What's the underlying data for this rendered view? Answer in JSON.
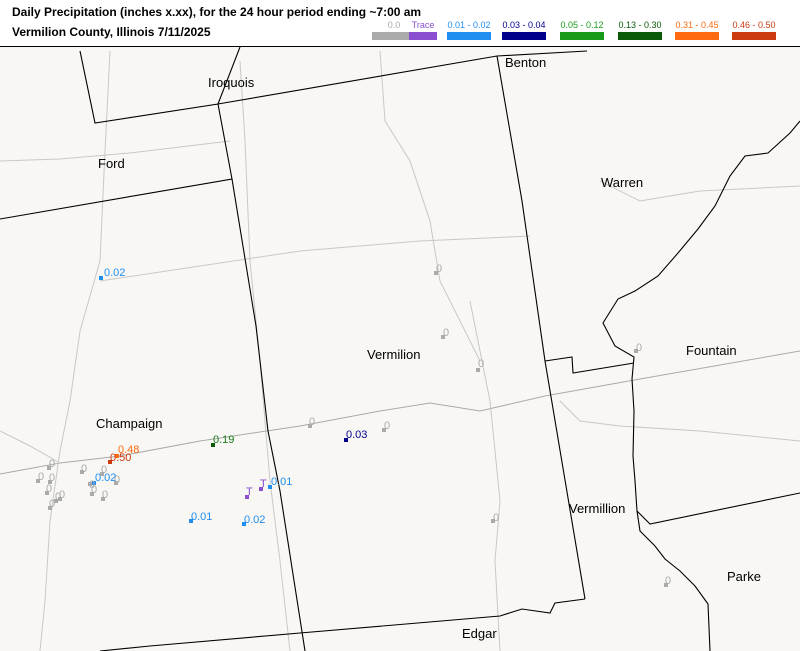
{
  "title_line1": "Daily Precipitation (inches  x.xx),  for the 24 hour period ending ~7:00 am",
  "title_line2": "Vermilion County, Illinois  7/11/2025",
  "legend": [
    {
      "label": "0.0",
      "color": "#aaaaaa"
    },
    {
      "label": "Trace",
      "color": "#8a4fd0"
    },
    {
      "label": "0.01 - 0.02",
      "color": "#1f8ef0"
    },
    {
      "label": "0.03 - 0.04",
      "color": "#00008b"
    },
    {
      "label": "0.05 - 0.12",
      "color": "#1a9a1a"
    },
    {
      "label": "0.13 - 0.30",
      "color": "#0a5a0a"
    },
    {
      "label": "0.31 - 0.45",
      "color": "#ff6a10"
    },
    {
      "label": "0.46 - 0.50",
      "color": "#cc3a10"
    }
  ],
  "counties": {
    "iroquois": "Iroquois",
    "benton": "Benton",
    "ford": "Ford",
    "warren": "Warren",
    "vermilion_il": "Vermilion",
    "fountain": "Fountain",
    "champaign": "Champaign",
    "vermillion_in": "Vermillion",
    "parke": "Parke",
    "edgar": "Edgar"
  },
  "stations": [
    {
      "value": "0.02",
      "color": "#1f8ef0"
    },
    {
      "value": "0",
      "color": "#aaaaaa"
    },
    {
      "value": "0",
      "color": "#aaaaaa"
    },
    {
      "value": "0",
      "color": "#aaaaaa"
    },
    {
      "value": "0",
      "color": "#aaaaaa"
    },
    {
      "value": "0",
      "color": "#aaaaaa"
    },
    {
      "value": "0",
      "color": "#aaaaaa"
    },
    {
      "value": "0",
      "color": "#aaaaaa"
    },
    {
      "value": "0.03",
      "color": "#00008b"
    },
    {
      "value": "0.19",
      "color": "#1a7a1a"
    },
    {
      "value": "0.48",
      "color": "#ff6a10"
    },
    {
      "value": "0.50",
      "color": "#cc3a10"
    },
    {
      "value": "0.02",
      "color": "#1f8ef0"
    },
    {
      "value": "T",
      "color": "#8a4fd0"
    },
    {
      "value": "T",
      "color": "#8a4fd0"
    },
    {
      "value": "0.01",
      "color": "#1f8ef0"
    },
    {
      "value": "0.01",
      "color": "#1f8ef0"
    },
    {
      "value": "0.02",
      "color": "#1f8ef0"
    },
    {
      "value": "0",
      "color": "#aaaaaa"
    },
    {
      "value": "0",
      "color": "#aaaaaa"
    },
    {
      "value": "0",
      "color": "#aaaaaa"
    },
    {
      "value": "0",
      "color": "#aaaaaa"
    },
    {
      "value": "0",
      "color": "#aaaaaa"
    },
    {
      "value": "0",
      "color": "#aaaaaa"
    },
    {
      "value": "0",
      "color": "#aaaaaa"
    },
    {
      "value": "0",
      "color": "#aaaaaa"
    },
    {
      "value": "0",
      "color": "#aaaaaa"
    },
    {
      "value": "0",
      "color": "#aaaaaa"
    },
    {
      "value": "0",
      "color": "#aaaaaa"
    },
    {
      "value": "0",
      "color": "#aaaaaa"
    },
    {
      "value": "0",
      "color": "#aaaaaa"
    },
    {
      "value": "0",
      "color": "#aaaaaa"
    }
  ]
}
